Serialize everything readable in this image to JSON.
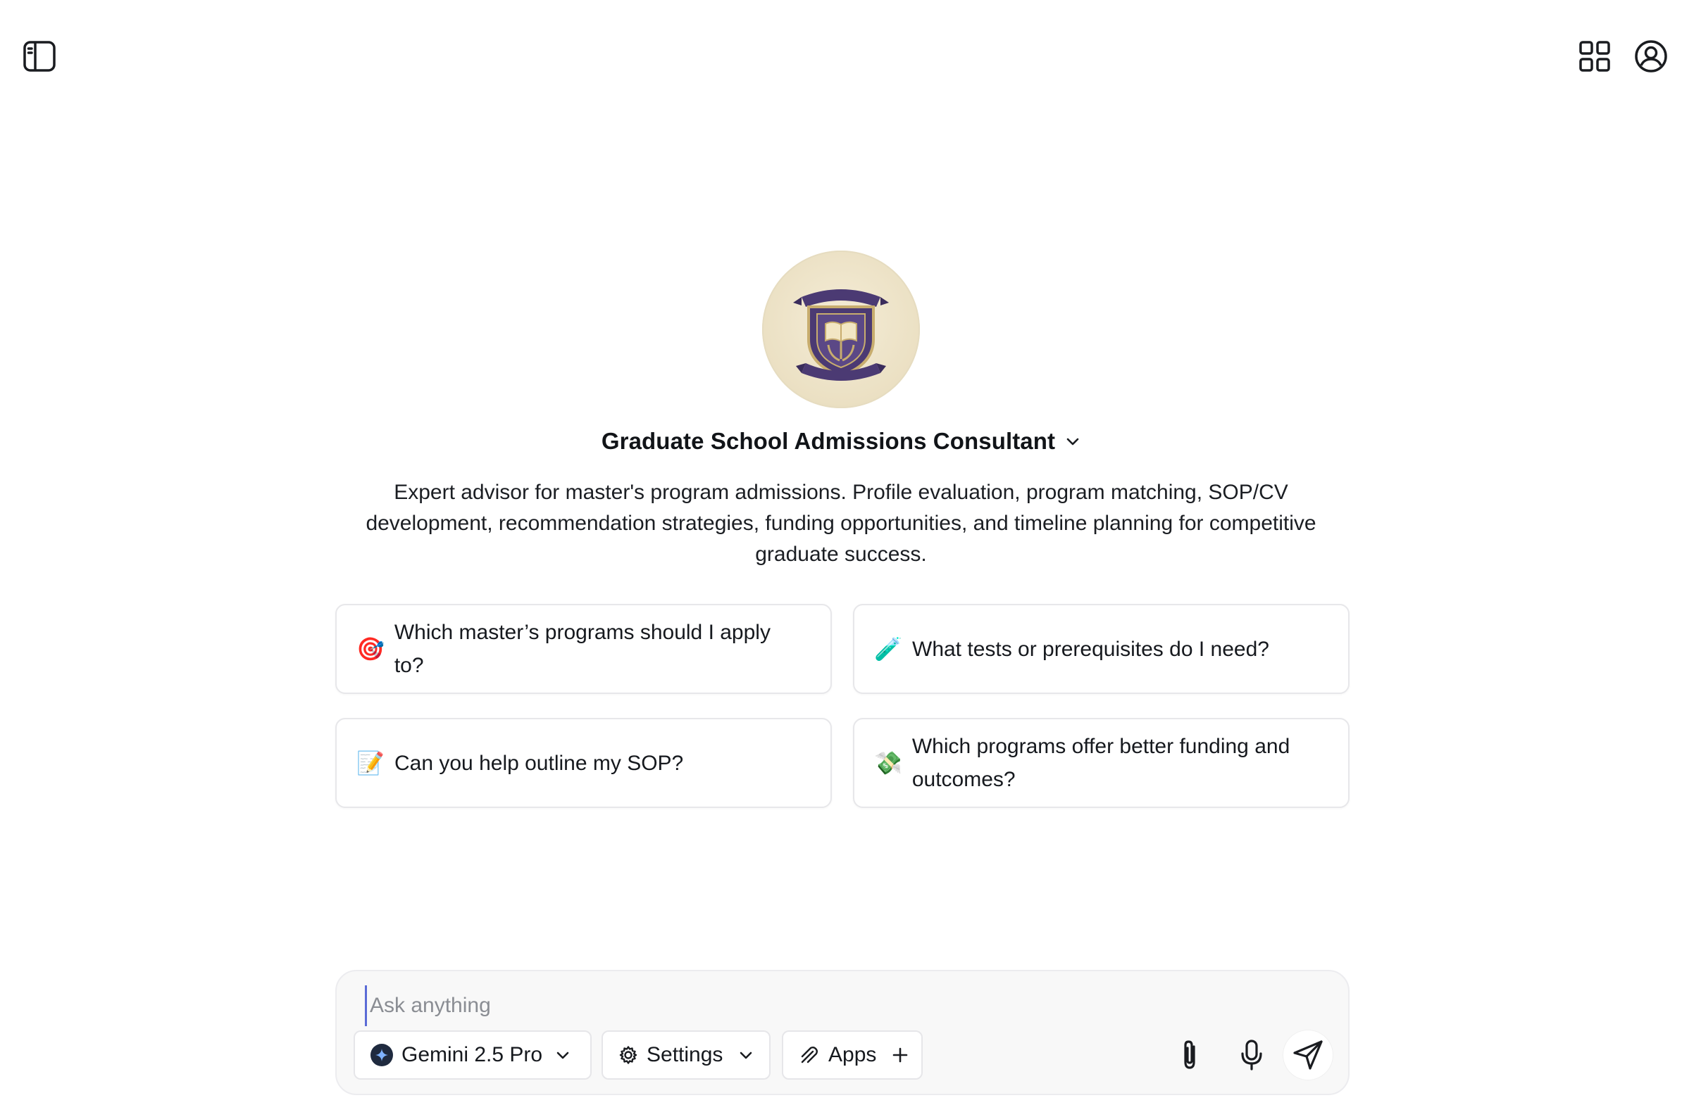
{
  "header": {
    "sidebar_toggle_icon": "sidebar-toggle-icon",
    "apps_icon": "apps-grid-icon",
    "profile_icon": "user-circle-icon"
  },
  "assistant": {
    "avatar": "graduate-crest-logo",
    "title": "Graduate School Admissions Consultant",
    "description": "Expert advisor for master's program admissions. Profile evaluation, program matching, SOP/CV development, recommendation strategies, funding opportunities, and timeline planning for competitive graduate success."
  },
  "suggestions": [
    {
      "emoji": "🎯",
      "label": "Which master’s programs should I apply to?"
    },
    {
      "emoji": "🧪",
      "label": "What tests or prerequisites do I need?"
    },
    {
      "emoji": "📝",
      "label": "Can you help outline my SOP?"
    },
    {
      "emoji": "💸",
      "label": "Which programs offer better funding and outcomes?"
    }
  ],
  "composer": {
    "placeholder": "Ask anything",
    "model_label": "Gemini 2.5 Pro",
    "settings_label": "Settings",
    "apps_label": "Apps"
  },
  "colors": {
    "accent_caret": "#5b6bd6",
    "avatar_bg": "#ebe0c3",
    "crest_purple": "#4b3a73"
  }
}
